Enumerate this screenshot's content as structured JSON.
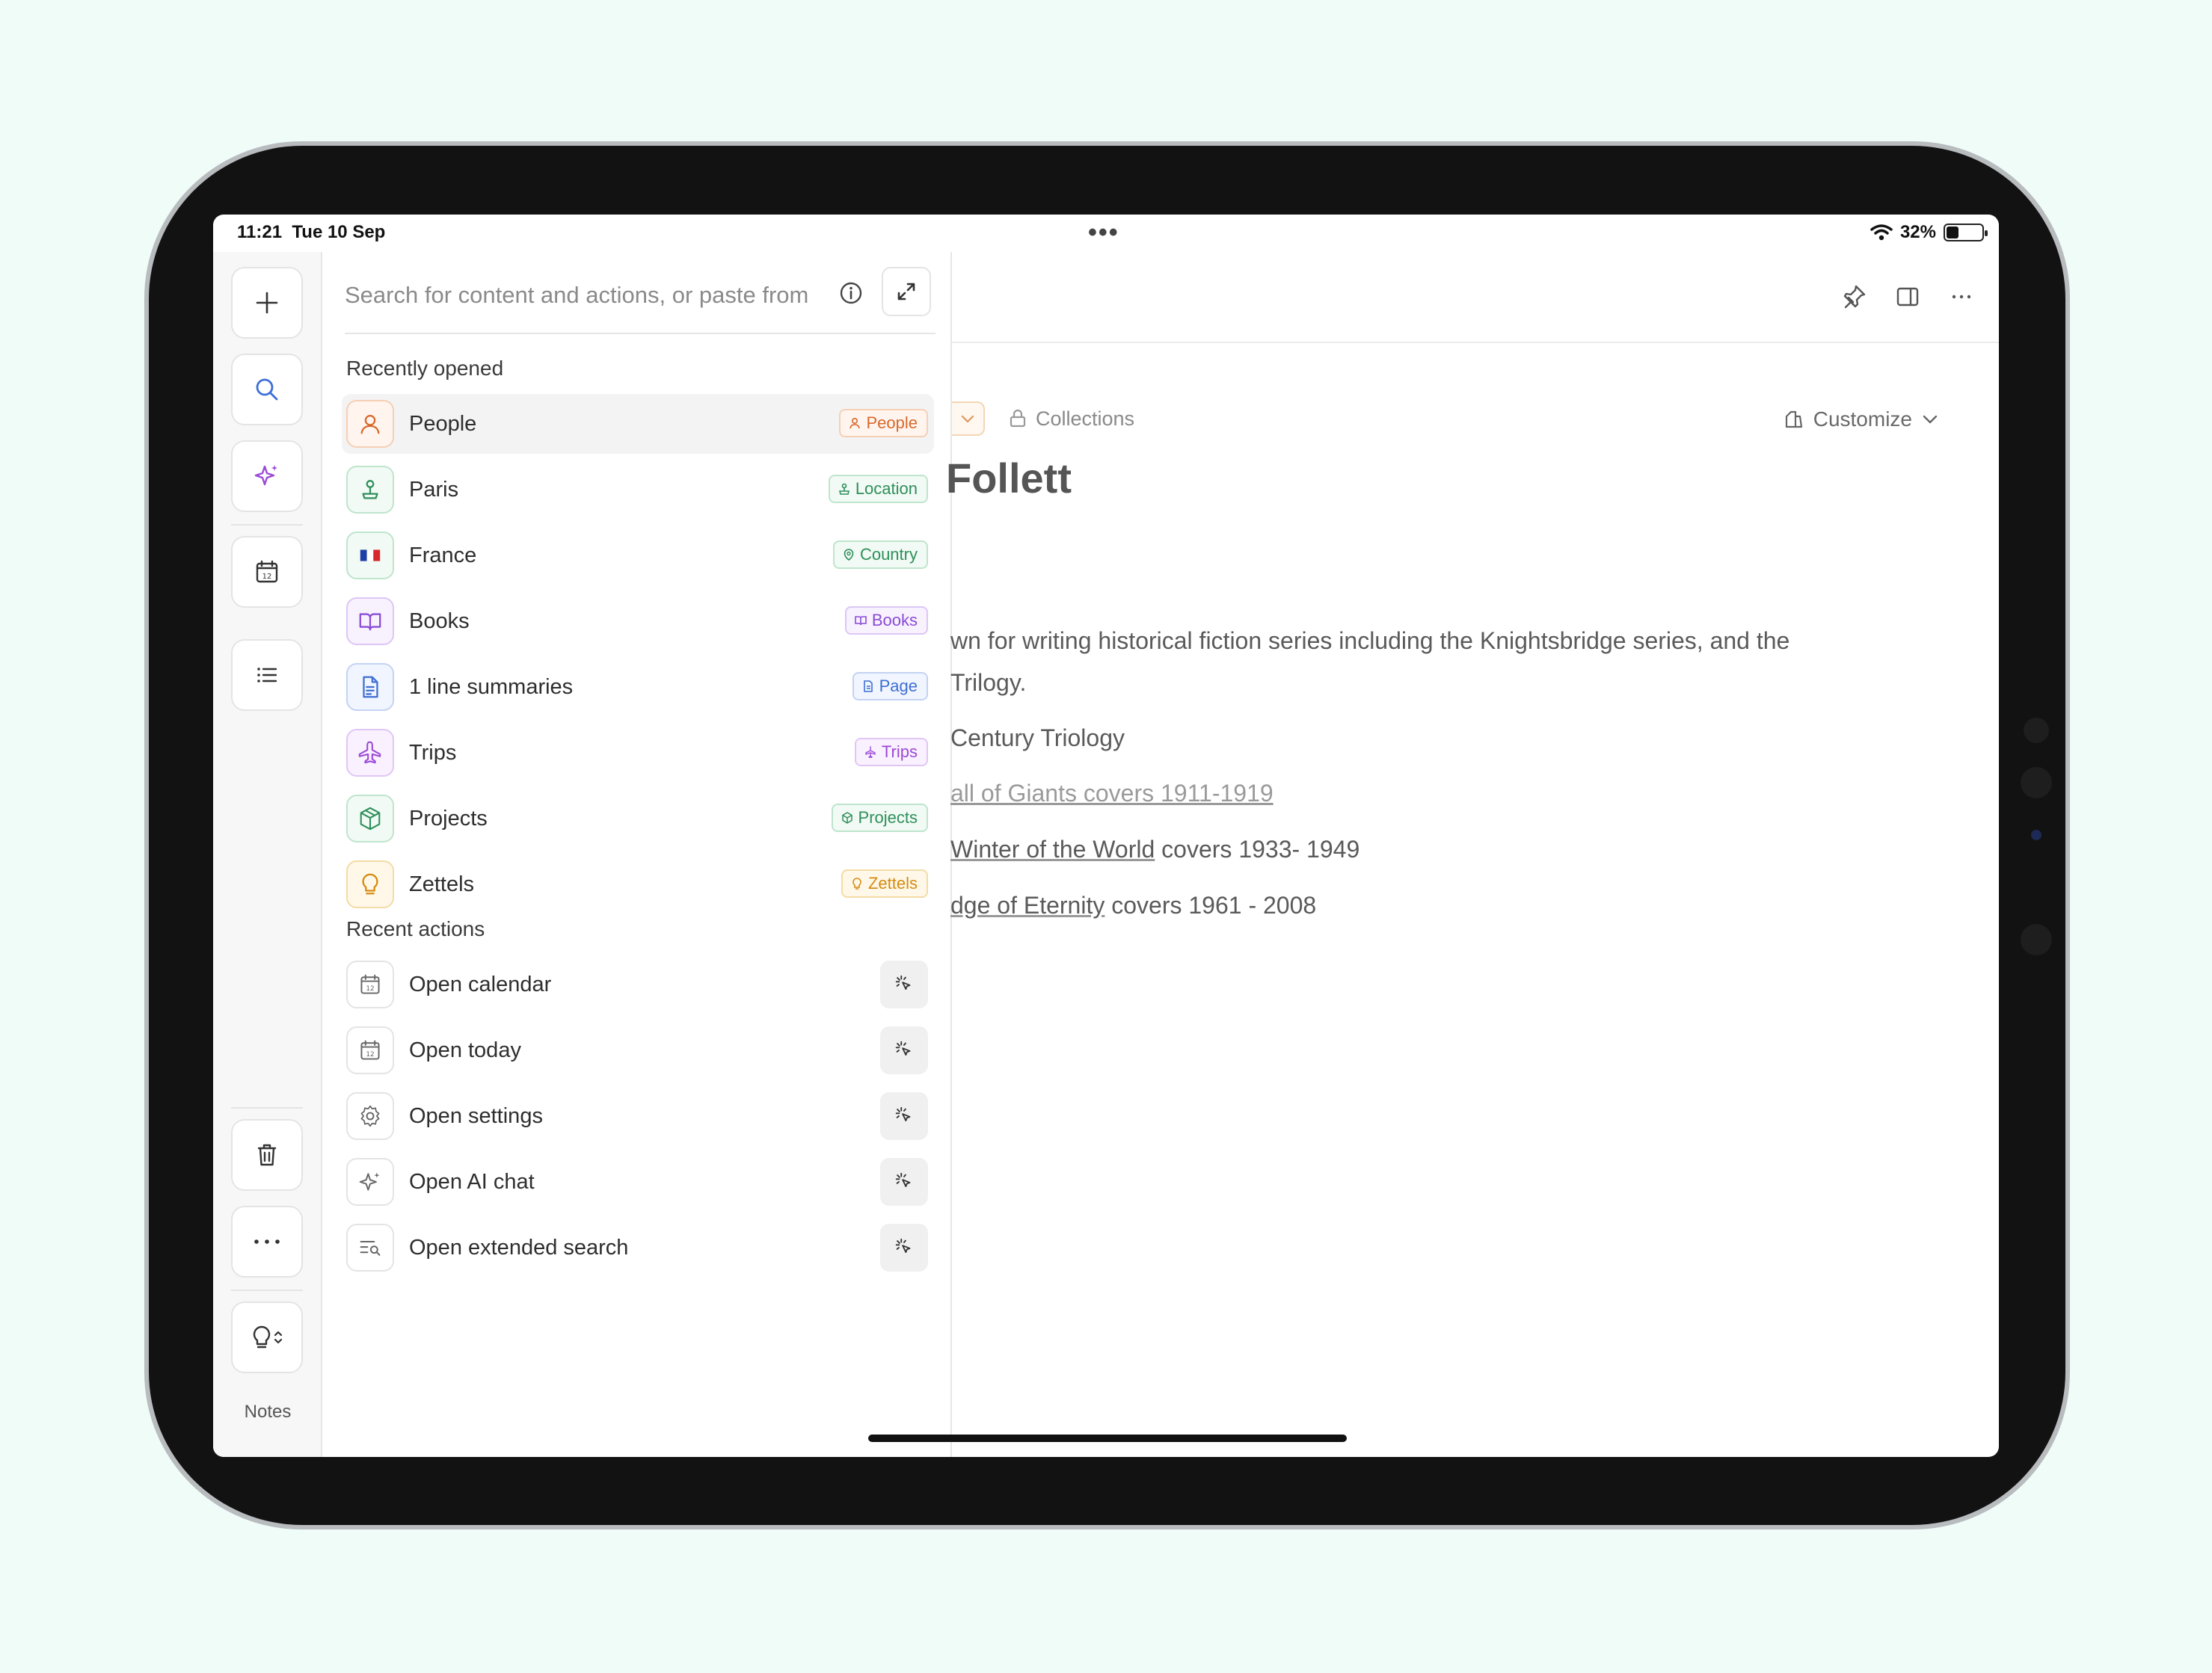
{
  "status_bar": {
    "time": "11:21",
    "date": "Tue 10 Sep",
    "dots": "•••",
    "battery": "32%",
    "battery_level": 0.32
  },
  "rail": {
    "notes_label": "Notes"
  },
  "search": {
    "placeholder": "Search for content and actions, or paste from"
  },
  "recently_opened": {
    "title": "Recently opened",
    "items": [
      {
        "label": "People",
        "tag": "People",
        "color": "#d9682b",
        "bg": "#fff5ee",
        "border": "#f5cfb4"
      },
      {
        "label": "Paris",
        "tag": "Location",
        "color": "#2f8f5b",
        "bg": "#f1faf4",
        "border": "#bfe5cd"
      },
      {
        "label": "France",
        "tag": "Country",
        "color": "#2f8f5b",
        "bg": "#f1faf4",
        "border": "#bfe5cd"
      },
      {
        "label": "Books",
        "tag": "Books",
        "color": "#8a4bd6",
        "bg": "#f8f2ff",
        "border": "#dcc7f5"
      },
      {
        "label": "1 line summaries",
        "tag": "Page",
        "color": "#3f6fd1",
        "bg": "#f1f5ff",
        "border": "#c4d3f3"
      },
      {
        "label": "Trips",
        "tag": "Trips",
        "color": "#9b49d6",
        "bg": "#f9f1ff",
        "border": "#e0c6f5"
      },
      {
        "label": "Projects",
        "tag": "Projects",
        "color": "#2f8f5b",
        "bg": "#f1faf4",
        "border": "#bfe5cd"
      },
      {
        "label": "Zettels",
        "tag": "Zettels",
        "color": "#d58b12",
        "bg": "#fff8e9",
        "border": "#f3dba5"
      }
    ]
  },
  "recent_actions": {
    "title": "Recent actions",
    "items": [
      {
        "label": "Open calendar"
      },
      {
        "label": "Open today"
      },
      {
        "label": "Open settings"
      },
      {
        "label": "Open AI chat"
      },
      {
        "label": "Open extended search"
      }
    ]
  },
  "main": {
    "collections": "Collections",
    "customize": "Customize",
    "title": "Follett",
    "p1_line1": "wn for writing historical fiction series including the Knightsbridge series, and the",
    "p1_line2": "Trilogy.",
    "p2": "Century Triology",
    "p3_link": "all of Giants covers 1911-1919",
    "p4_link": "Winter of the World",
    "p4_rest": " covers 1933- 1949",
    "p5_link": "dge of Eternity",
    "p5_rest": " covers 1961 - 2008"
  }
}
